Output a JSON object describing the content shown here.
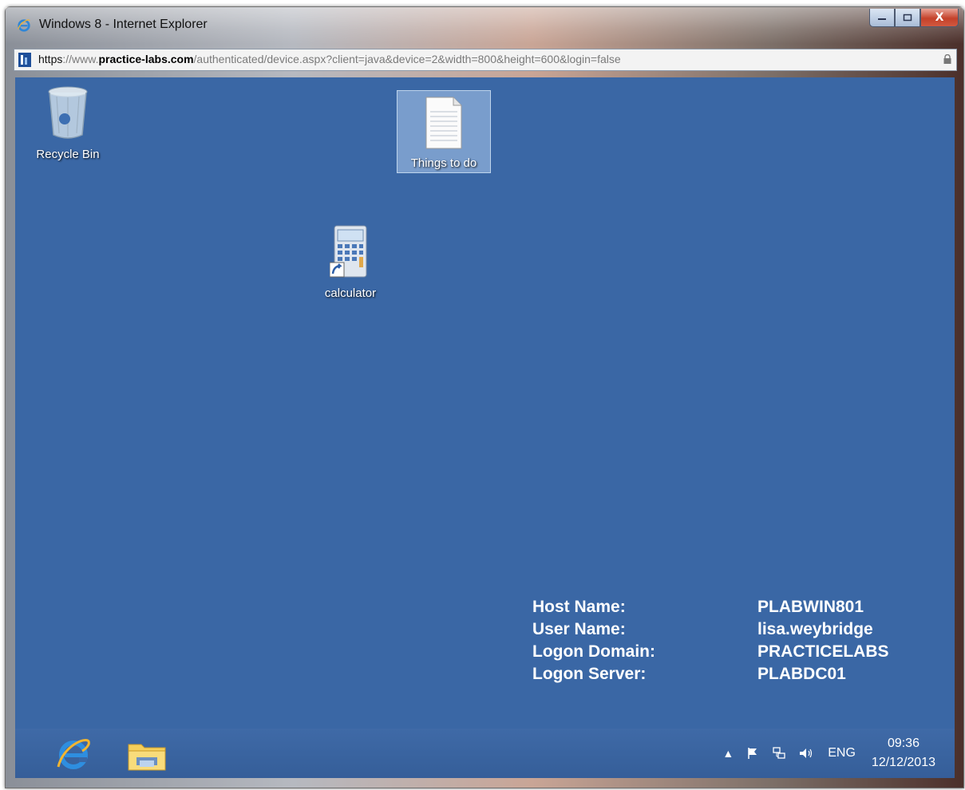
{
  "window": {
    "title": "Windows 8 - Internet Explorer",
    "min_icon": "minimize-icon",
    "max_icon": "maximize-icon",
    "close_label": "X"
  },
  "address": {
    "scheme": "https",
    "sep": "://",
    "www": "www.",
    "domain": "practice-labs.com",
    "path": "/authenticated/device.aspx?client=java&device=2&width=800&height=600&login=false"
  },
  "desktop": {
    "icons": [
      {
        "label": "Recycle Bin",
        "icon": "recycle-bin-icon"
      },
      {
        "label": "Things to do",
        "icon": "text-document-icon"
      },
      {
        "label": "calculator",
        "icon": "calculator-icon"
      }
    ],
    "info": [
      {
        "key": "Host Name:",
        "value": "PLABWIN801"
      },
      {
        "key": "User Name:",
        "value": "lisa.weybridge"
      },
      {
        "key": "Logon Domain:",
        "value": "PRACTICELABS"
      },
      {
        "key": "Logon Server:",
        "value": "PLABDC01"
      }
    ]
  },
  "taskbar": {
    "pinned": [
      "internet-explorer-icon",
      "file-explorer-icon"
    ],
    "tray": {
      "language": "ENG",
      "time": "09:36",
      "date": "12/12/2013"
    }
  },
  "colors": {
    "desktop": "#3a67a5",
    "taskbar": "#355e99"
  }
}
